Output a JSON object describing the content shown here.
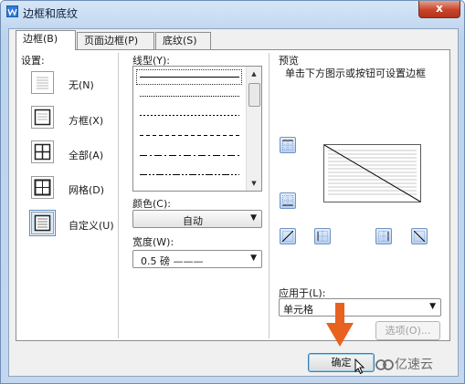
{
  "window": {
    "title": "边框和底纹",
    "close_label": "x"
  },
  "tabs": [
    {
      "label": "边框(B)"
    },
    {
      "label": "页面边框(P)"
    },
    {
      "label": "底纹(S)"
    }
  ],
  "settings": {
    "heading": "设置:",
    "items": [
      {
        "label": "无(N)",
        "icon": "no-border-icon"
      },
      {
        "label": "方框(X)",
        "icon": "box-border-icon"
      },
      {
        "label": "全部(A)",
        "icon": "all-borders-icon"
      },
      {
        "label": "网格(D)",
        "icon": "grid-border-icon"
      },
      {
        "label": "自定义(U)",
        "icon": "custom-border-icon"
      }
    ]
  },
  "line_style": {
    "heading": "线型(Y):",
    "options": [
      "solid",
      "dotted-fine",
      "dotted",
      "dashed",
      "dash-dot",
      "dash-dot-dot",
      "long-dash"
    ]
  },
  "color": {
    "label": "颜色(C):",
    "value": "自动"
  },
  "width": {
    "label": "宽度(W):",
    "value": "0.5  磅 ———"
  },
  "preview": {
    "heading": "预览",
    "hint": "单击下方图示或按钮可设置边框"
  },
  "apply_to": {
    "label": "应用于(L):",
    "value": "单元格"
  },
  "buttons": {
    "options": "选项(O)...",
    "ok": "确定"
  },
  "watermark": {
    "text": "亿速云"
  },
  "colors": {
    "accent_arrow": "#e8611f",
    "title_bg": "#c3d7ef",
    "close_bg": "#c7442a"
  }
}
